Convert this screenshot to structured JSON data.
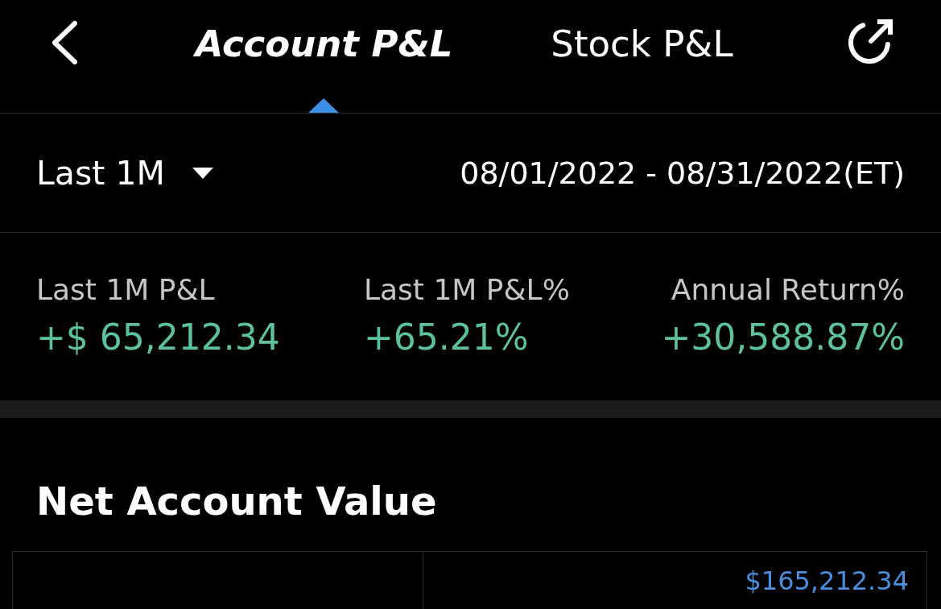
{
  "header": {
    "tabs": [
      {
        "label": "Account P&L",
        "selected": true
      },
      {
        "label": "Stock P&L",
        "selected": false
      }
    ]
  },
  "period": {
    "selector": "Last 1M",
    "date_range": "08/01/2022 - 08/31/2022(ET)"
  },
  "stats": [
    {
      "label": "Last 1M P&L",
      "value": "+$ 65,212.34"
    },
    {
      "label": "Last 1M P&L%",
      "value": "+65.21%"
    },
    {
      "label": "Annual Return%",
      "value": "+30,588.87%"
    }
  ],
  "net_account_value": {
    "title": "Net Account Value",
    "top_value": "$165,212.34"
  }
}
